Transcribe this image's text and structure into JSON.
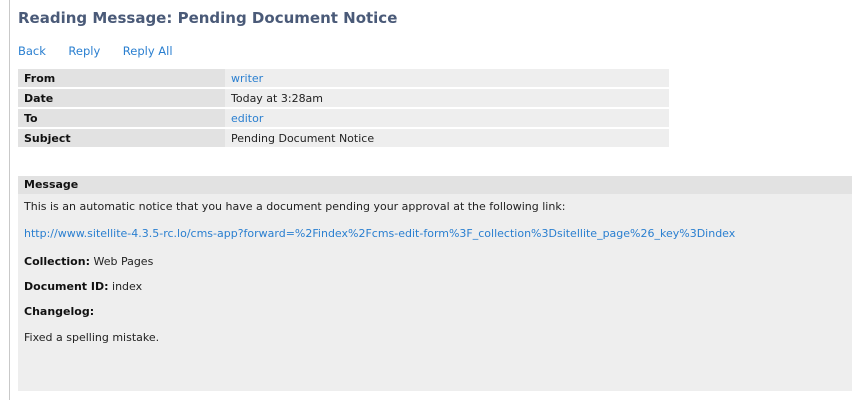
{
  "page": {
    "title": "Reading Message: Pending Document Notice"
  },
  "actions": {
    "back": "Back",
    "reply": "Reply",
    "reply_all": "Reply All"
  },
  "meta": {
    "from_label": "From",
    "from_value": "writer",
    "date_label": "Date",
    "date_value": "Today at 3:28am",
    "to_label": "To",
    "to_value": "editor",
    "subject_label": "Subject",
    "subject_value": "Pending Document Notice"
  },
  "message": {
    "header": "Message",
    "intro": "This is an automatic notice that you have a document pending your approval at the following link:",
    "link": "http://www.sitellite-4.3.5-rc.lo/cms-app?forward=%2Findex%2Fcms-edit-form%3F_collection%3Dsitellite_page%26_key%3Dindex",
    "collection_label": "Collection:",
    "collection_value": " Web Pages",
    "docid_label": "Document ID:",
    "docid_value": " index",
    "changelog_label": "Changelog:",
    "changelog_text": "Fixed a spelling mistake."
  },
  "colors": {
    "title": "#4a5a78",
    "link": "#2a7fd0",
    "label_bg": "#e2e2e2",
    "value_bg": "#eeeeee"
  }
}
